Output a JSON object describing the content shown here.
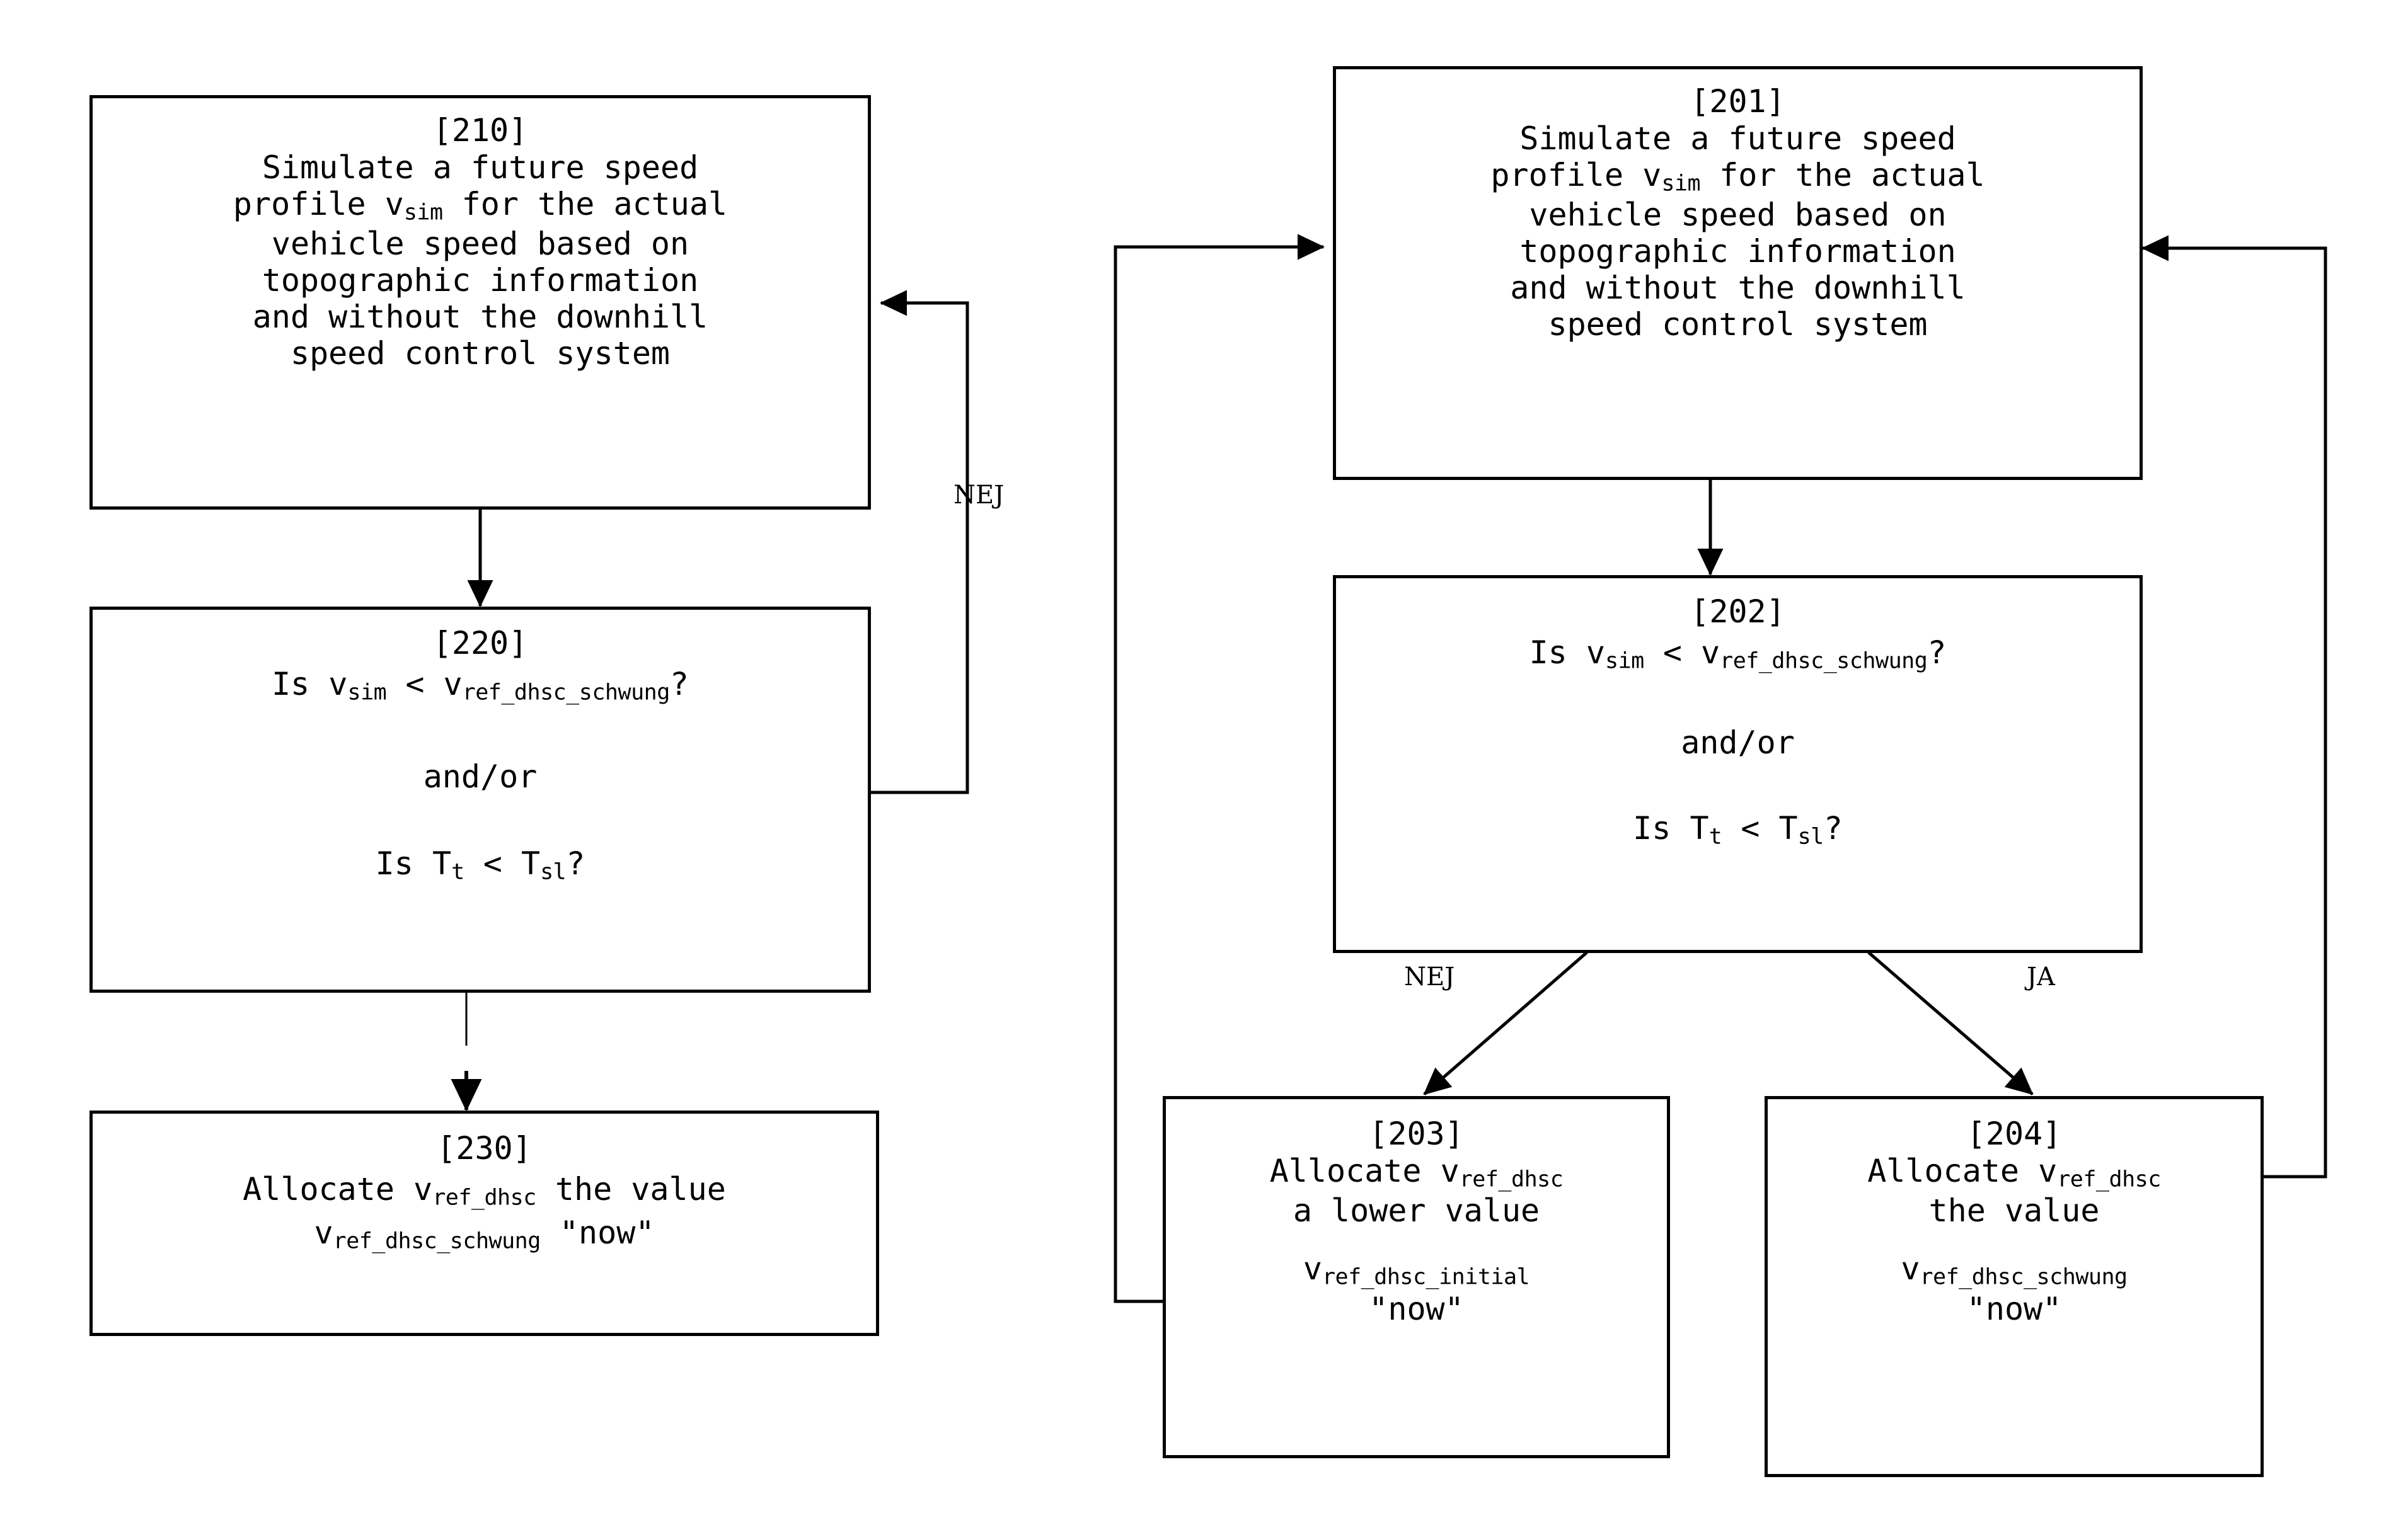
{
  "diagram": {
    "title_absent": true,
    "background_color": "#ffffff",
    "line_color": "#000000"
  },
  "left_flow": {
    "nodes": [
      {
        "id": "210",
        "id_label": "[210]",
        "lines": [
          {
            "pre": "Simulate a future speed",
            "sub": "",
            "post": ""
          },
          {
            "pre": "profile v",
            "sub": "sim",
            "post": " for the actual"
          },
          {
            "pre": "vehicle speed based on",
            "sub": "",
            "post": ""
          },
          {
            "pre": "topographic information",
            "sub": "",
            "post": ""
          },
          {
            "pre": "and without the downhill",
            "sub": "",
            "post": ""
          },
          {
            "pre": "speed control system",
            "sub": "",
            "post": ""
          }
        ]
      },
      {
        "id": "220",
        "id_label": "[220]",
        "lines": [
          {
            "pre": "Is v",
            "sub": "sim",
            "post": " < v"
          },
          {
            "pre": "and/or",
            "sub": "",
            "post": ""
          },
          {
            "pre": "Is T",
            "sub": "t",
            "post": " < T"
          }
        ],
        "q1_prefix": "Is v",
        "q1_sub1": "sim",
        "q1_mid": " < v",
        "q1_sub2": "ref_dhsc_schwung",
        "q1_suffix": "?",
        "connector": "and/or",
        "q2_prefix": "Is T",
        "q2_sub1": "t",
        "q2_mid": " < T",
        "q2_sub2": "sl",
        "q2_suffix": "?"
      },
      {
        "id": "230",
        "id_label": "[230]",
        "line1_pre": "Allocate v",
        "line1_sub": "ref_dhsc",
        "line1_post": " the value",
        "line2_pre": "v",
        "line2_sub": "ref_dhsc_schwung",
        "line2_post": " \"now\""
      }
    ],
    "edges": [
      {
        "from": "210",
        "to": "220",
        "label": ""
      },
      {
        "from": "220",
        "to": "230",
        "label": ""
      },
      {
        "from": "220",
        "to": "210",
        "label": "NEJ"
      }
    ]
  },
  "right_flow": {
    "nodes": [
      {
        "id": "201",
        "id_label": "[201]",
        "lines": [
          {
            "pre": "Simulate a future speed",
            "sub": "",
            "post": ""
          },
          {
            "pre": "profile v",
            "sub": "sim",
            "post": " for the actual"
          },
          {
            "pre": "vehicle speed based on",
            "sub": "",
            "post": ""
          },
          {
            "pre": "topographic information",
            "sub": "",
            "post": ""
          },
          {
            "pre": "and without the downhill",
            "sub": "",
            "post": ""
          },
          {
            "pre": "speed control system",
            "sub": "",
            "post": ""
          }
        ]
      },
      {
        "id": "202",
        "id_label": "[202]",
        "q1_prefix": "Is v",
        "q1_sub1": "sim",
        "q1_mid": " < v",
        "q1_sub2": "ref_dhsc_schwung",
        "q1_suffix": "?",
        "connector": "and/or",
        "q2_prefix": "Is T",
        "q2_sub1": "t",
        "q2_mid": " < T",
        "q2_sub2": "sl",
        "q2_suffix": "?"
      },
      {
        "id": "203",
        "id_label": "[203]",
        "line1_pre": "Allocate v",
        "line1_sub": "ref_dhsc",
        "line2": "a lower value",
        "line3_pre": "v",
        "line3_sub": "ref_dhsc_initial",
        "line4": "\"now\""
      },
      {
        "id": "204",
        "id_label": "[204]",
        "line1_pre": "Allocate v",
        "line1_sub": "ref_dhsc",
        "line2": "the value",
        "line3_pre": "v",
        "line3_sub": "ref_dhsc_schwung",
        "line4": "\"now\""
      }
    ],
    "edges": [
      {
        "from": "201",
        "to": "202",
        "label": ""
      },
      {
        "from": "202",
        "to": "203",
        "label": "NEJ"
      },
      {
        "from": "202",
        "to": "204",
        "label": "JA"
      },
      {
        "from": "203",
        "to": "201",
        "label": ""
      },
      {
        "from": "204",
        "to": "201",
        "label": ""
      }
    ]
  },
  "labels": {
    "left_nej": "NEJ",
    "right_nej": "NEJ",
    "right_ja": "JA"
  }
}
